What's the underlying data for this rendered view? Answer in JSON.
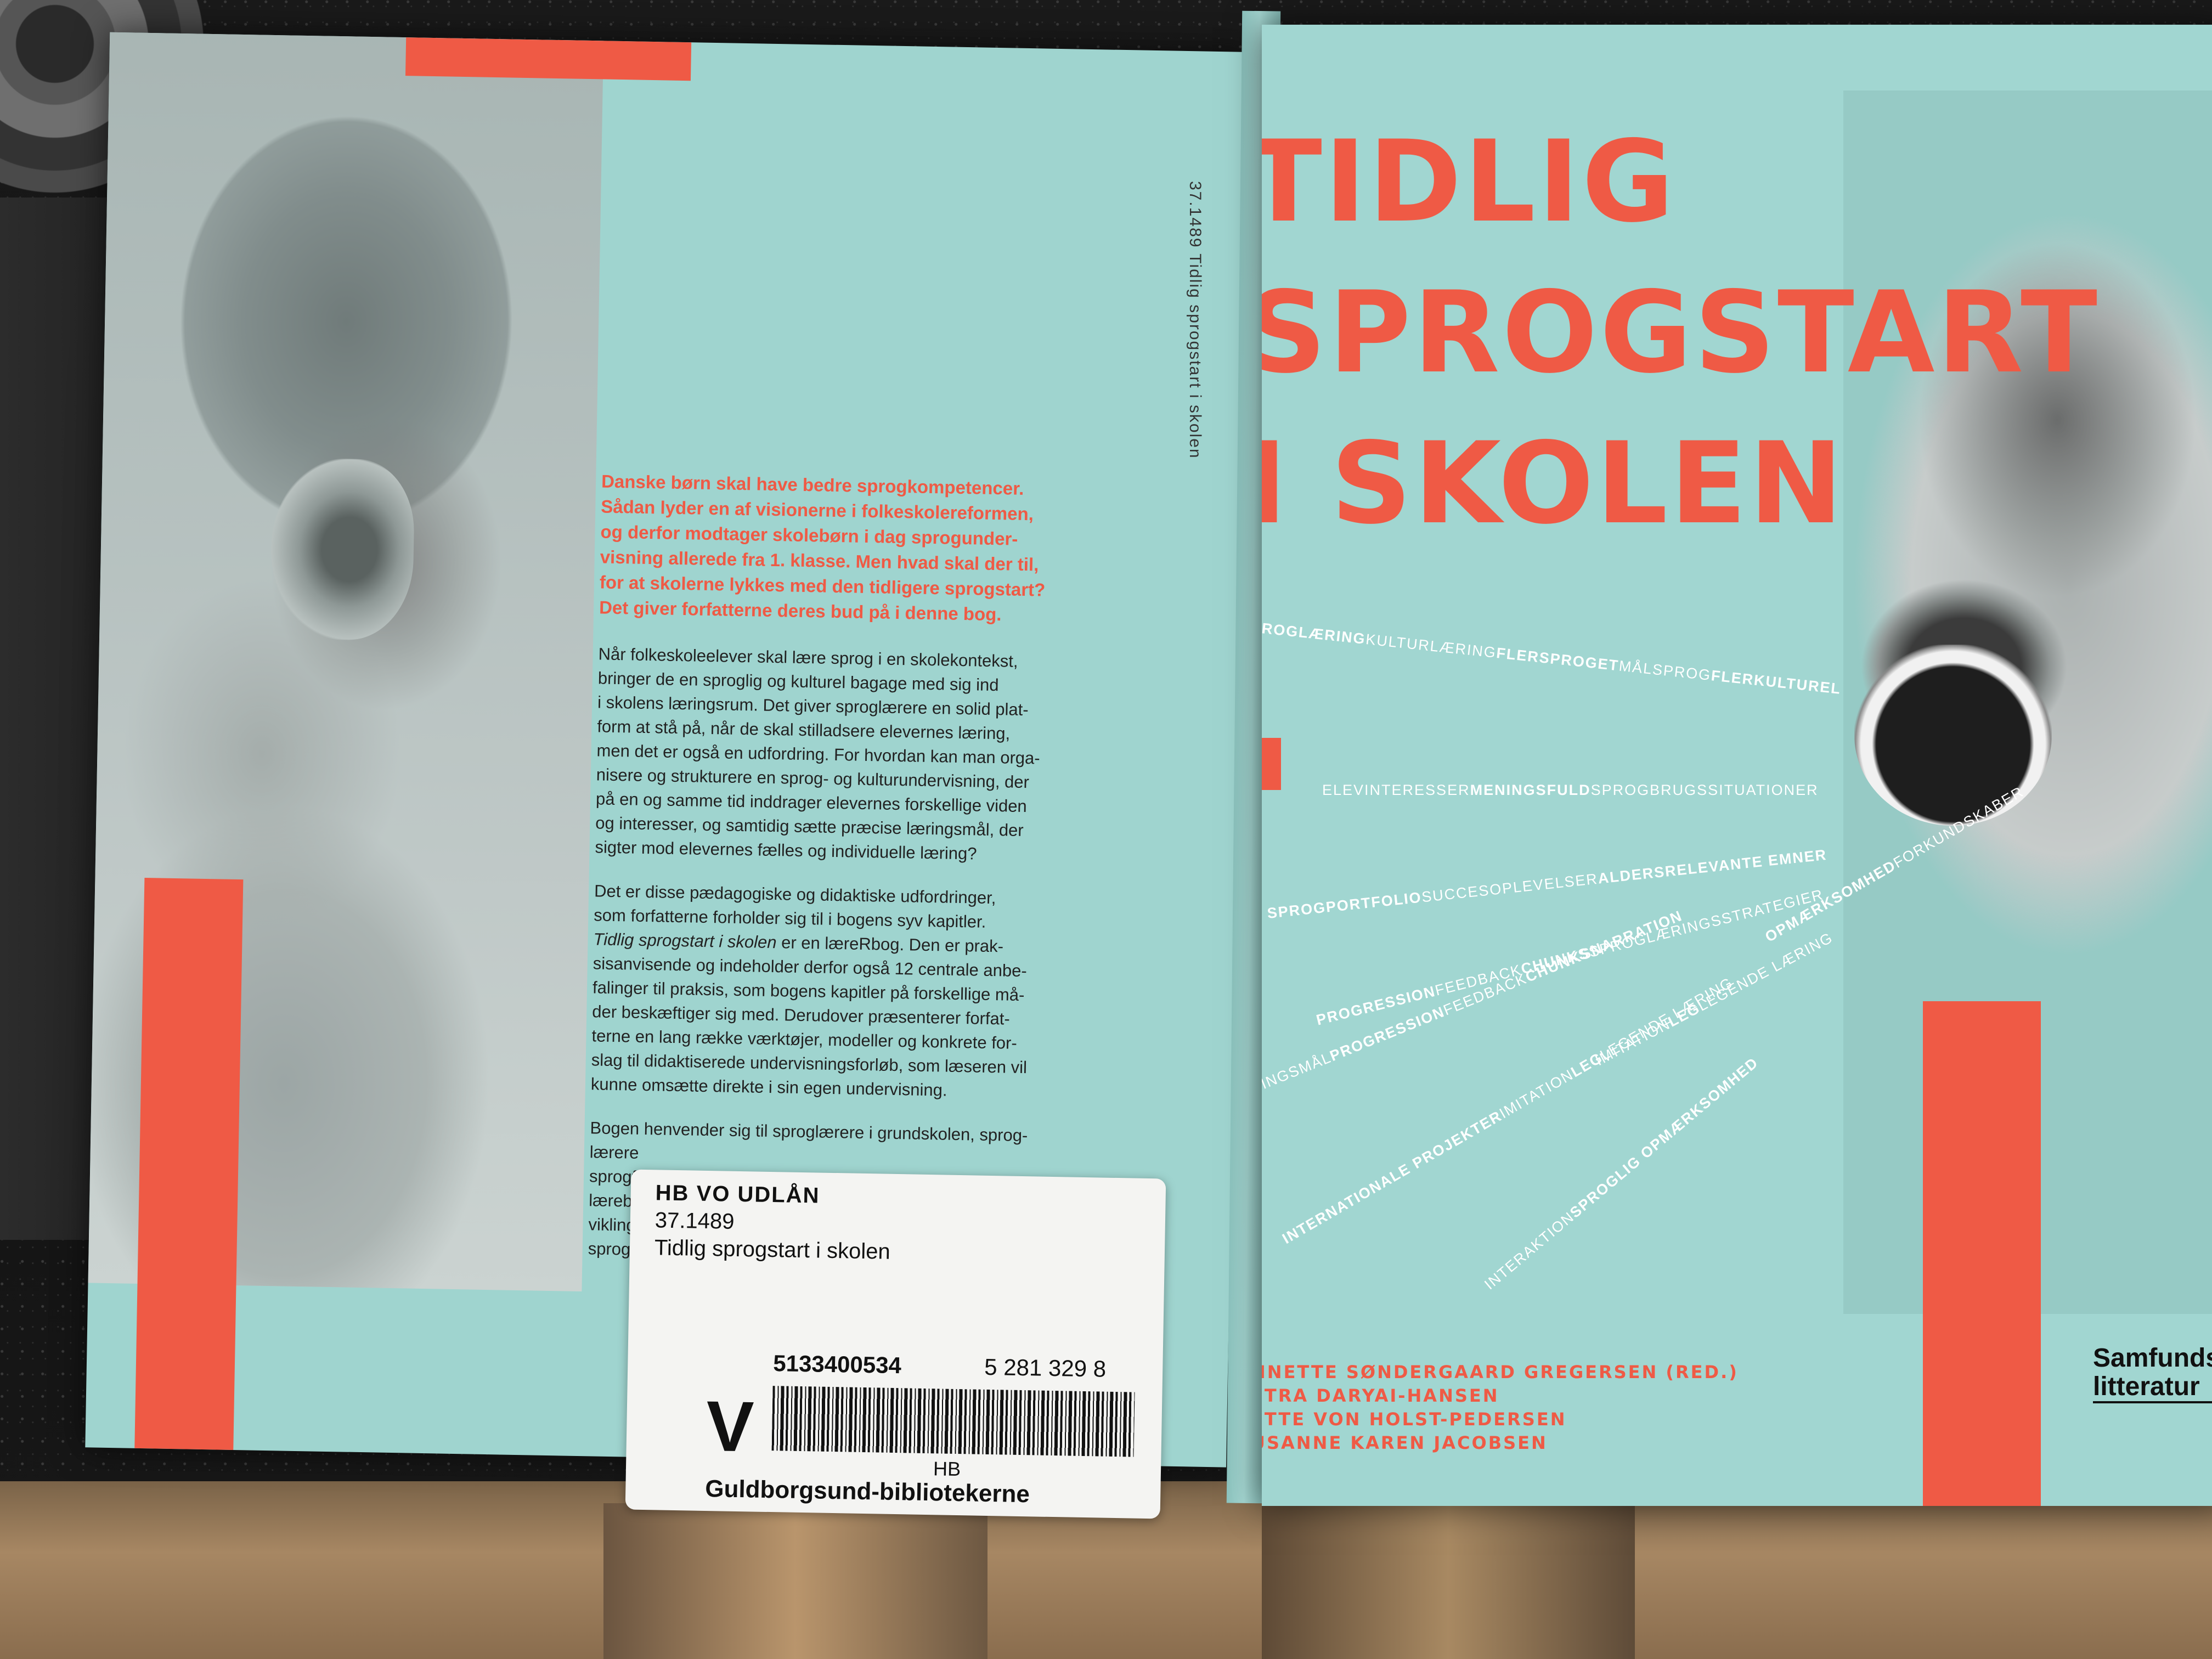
{
  "back_cover": {
    "lead": "Danske børn skal have bedre sprogkompetencer.\nSådan lyder en af visionerne i folkeskolereformen,\nog derfor modtager skolebørn i dag sprogunder-\nvisning allerede fra 1. klasse. Men hvad skal der til,\nfor at skolerne lykkes med den tidligere sprogstart?\nDet giver forfatterne deres bud på i denne bog.",
    "paragraph_1": "Når folkeskoleelever skal lære sprog i en skolekontekst,\nbringer de en sproglig og kulturel bagage med sig ind\ni skolens læringsrum. Det giver sproglærere en solid plat-\nform at stå på, når de skal stilladsere elevernes læring,\nmen det er også en udfordring. For hvordan kan man orga-\nnisere og strukturere en sprog- og kulturundervisning, der\npå en og samme tid inddrager elevernes forskellige viden\nog interesser, og samtidig sætte præcise læringsmål, der\nsigter mod elevernes fælles og individuelle læring?",
    "paragraph_2_intro": "Det er disse pædagogiske og didaktiske udfordringer,\nsom forfatterne forholder sig til i bogens syv kapitler.",
    "paragraph_2_title": "Tidlig sprogstart i skolen",
    "paragraph_2_rest": " er en læreRbog. Den er prak-\nsisanvisende og indeholder derfor også 12 centrale anbe-\nfalinger til praksis, som bogens kapitler på forskellige må-\nder beskæftiger sig med. Derudover præsenterer forfat-\nterne en lang række værktøjer, modeller og konkrete for-\nslag til didaktiserede undervisningsforløb, som læseren vil\nkunne omsætte direkte i sin egen undervisning.",
    "paragraph_3": "Bogen henvender sig til sproglærere i grundskolen, sprog-\nlærere\nsprogf\nlærebo\nvikling\nsproge"
  },
  "sticker": {
    "code": "HB   VO   UDLÅN",
    "classification": "37.1489",
    "title": "Tidlig sprogstart i skolen",
    "barcode_number": "5133400534",
    "isbn_fragment": "5 281 329 8",
    "letter": "V",
    "branch": "HB",
    "library": "Guldborgsund-bibliotekerne"
  },
  "spine": {
    "text": "37.1489   Tidlig sprogstart i skolen"
  },
  "front_cover": {
    "title": "TIDLIG\nSPROGSTART\nI SKOLEN",
    "keyword_lines": [
      {
        "parts": [
          {
            "t": "ROGLÆRING",
            "b": true
          },
          {
            "t": "KULTURLÆRING",
            "b": false
          },
          {
            "t": "FLERSPROGET",
            "b": true
          },
          {
            "t": "MÅLSPROG",
            "b": false
          },
          {
            "t": "FLERKULTUREL",
            "b": true
          }
        ]
      },
      {
        "parts": [
          {
            "t": "ELEVINTERESSER",
            "b": false
          },
          {
            "t": "MENINGSFULD",
            "b": true
          },
          {
            "t": "SPROGBRUGSSITUATIONER",
            "b": false
          }
        ]
      },
      {
        "parts": [
          {
            "t": "SPROGPORTFOLIO",
            "b": true
          },
          {
            "t": "SUCCESOPLEVELSER",
            "b": false
          },
          {
            "t": "ALDERSRELEVANTE EMNER",
            "b": true
          }
        ]
      },
      {
        "parts": [
          {
            "t": "PROGRESSION",
            "b": true
          },
          {
            "t": "FEEDBACK",
            "b": false
          },
          {
            "t": "CHUNKS",
            "b": true
          },
          {
            "t": "SPROGLÆRINGSSTRATEGIER",
            "b": false
          }
        ]
      },
      {
        "parts": [
          {
            "t": "RINGSMÅL",
            "b": false
          },
          {
            "t": "PROGRESSION",
            "b": true
          },
          {
            "t": "FEEDBACK",
            "b": false
          },
          {
            "t": "CHUNKS",
            "b": true
          },
          {
            "t": "NARRATION",
            "b": true
          }
        ]
      },
      {
        "parts": [
          {
            "t": "IMITATION",
            "b": false
          },
          {
            "t": "LEG",
            "b": true
          },
          {
            "t": "LEGENDE LÆRING",
            "b": false
          }
        ]
      },
      {
        "parts": [
          {
            "t": "INTERNATIONALE PROJEKTER",
            "b": true
          },
          {
            "t": "IMITATION",
            "b": false
          },
          {
            "t": "LEG",
            "b": true
          },
          {
            "t": "LEGENDE LÆRING",
            "b": false
          }
        ]
      },
      {
        "parts": [
          {
            "t": "OPMÆRKSOMHED",
            "b": true
          },
          {
            "t": "FORKUNDSKABER",
            "b": false
          }
        ]
      },
      {
        "parts": [
          {
            "t": "INTERAKTION",
            "b": false
          },
          {
            "t": "SPROGLIG OPMÆRKSOMHED",
            "b": true
          }
        ]
      }
    ],
    "authors": "NNETTE SØNDERGAARD GREGERSEN (RED.)\nETRA DARYAI-HANSEN\nETTE VON HOLST-PEDERSEN\nUSANNE KAREN JACOBSEN",
    "publisher": "Samfunds\nlitteratur"
  },
  "colors": {
    "cover_teal": "#9fd4cf",
    "accent_red": "#ef5a45",
    "keyword_white": "#ffffff"
  }
}
